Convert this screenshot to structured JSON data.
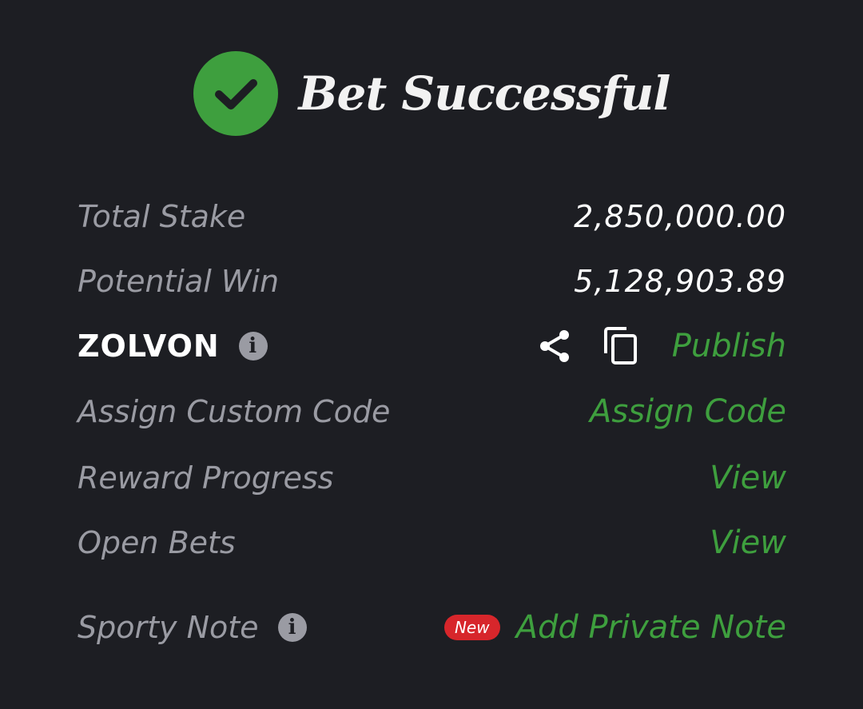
{
  "header": {
    "title": "Bet Successful"
  },
  "rows": {
    "total_stake": {
      "label": "Total Stake",
      "value": "2,850,000.00"
    },
    "potential_win": {
      "label": "Potential Win",
      "value": "5,128,903.89"
    },
    "booking": {
      "code": "ZOLVON",
      "publish_label": "Publish"
    },
    "custom_code": {
      "label": "Assign Custom Code",
      "action": "Assign Code"
    },
    "reward_progress": {
      "label": "Reward Progress",
      "action": "View"
    },
    "open_bets": {
      "label": "Open Bets",
      "action": "View"
    },
    "sporty_note": {
      "label": "Sporty Note",
      "badge": "New",
      "action": "Add Private Note"
    }
  },
  "colors": {
    "background": "#1d1e23",
    "accent_green": "#3e9f3e",
    "muted_text": "#9a9ba3",
    "badge_red": "#d7262b"
  },
  "icons": {
    "success": "check-circle-icon",
    "info": "info-icon",
    "share": "share-icon",
    "copy": "copy-icon"
  }
}
